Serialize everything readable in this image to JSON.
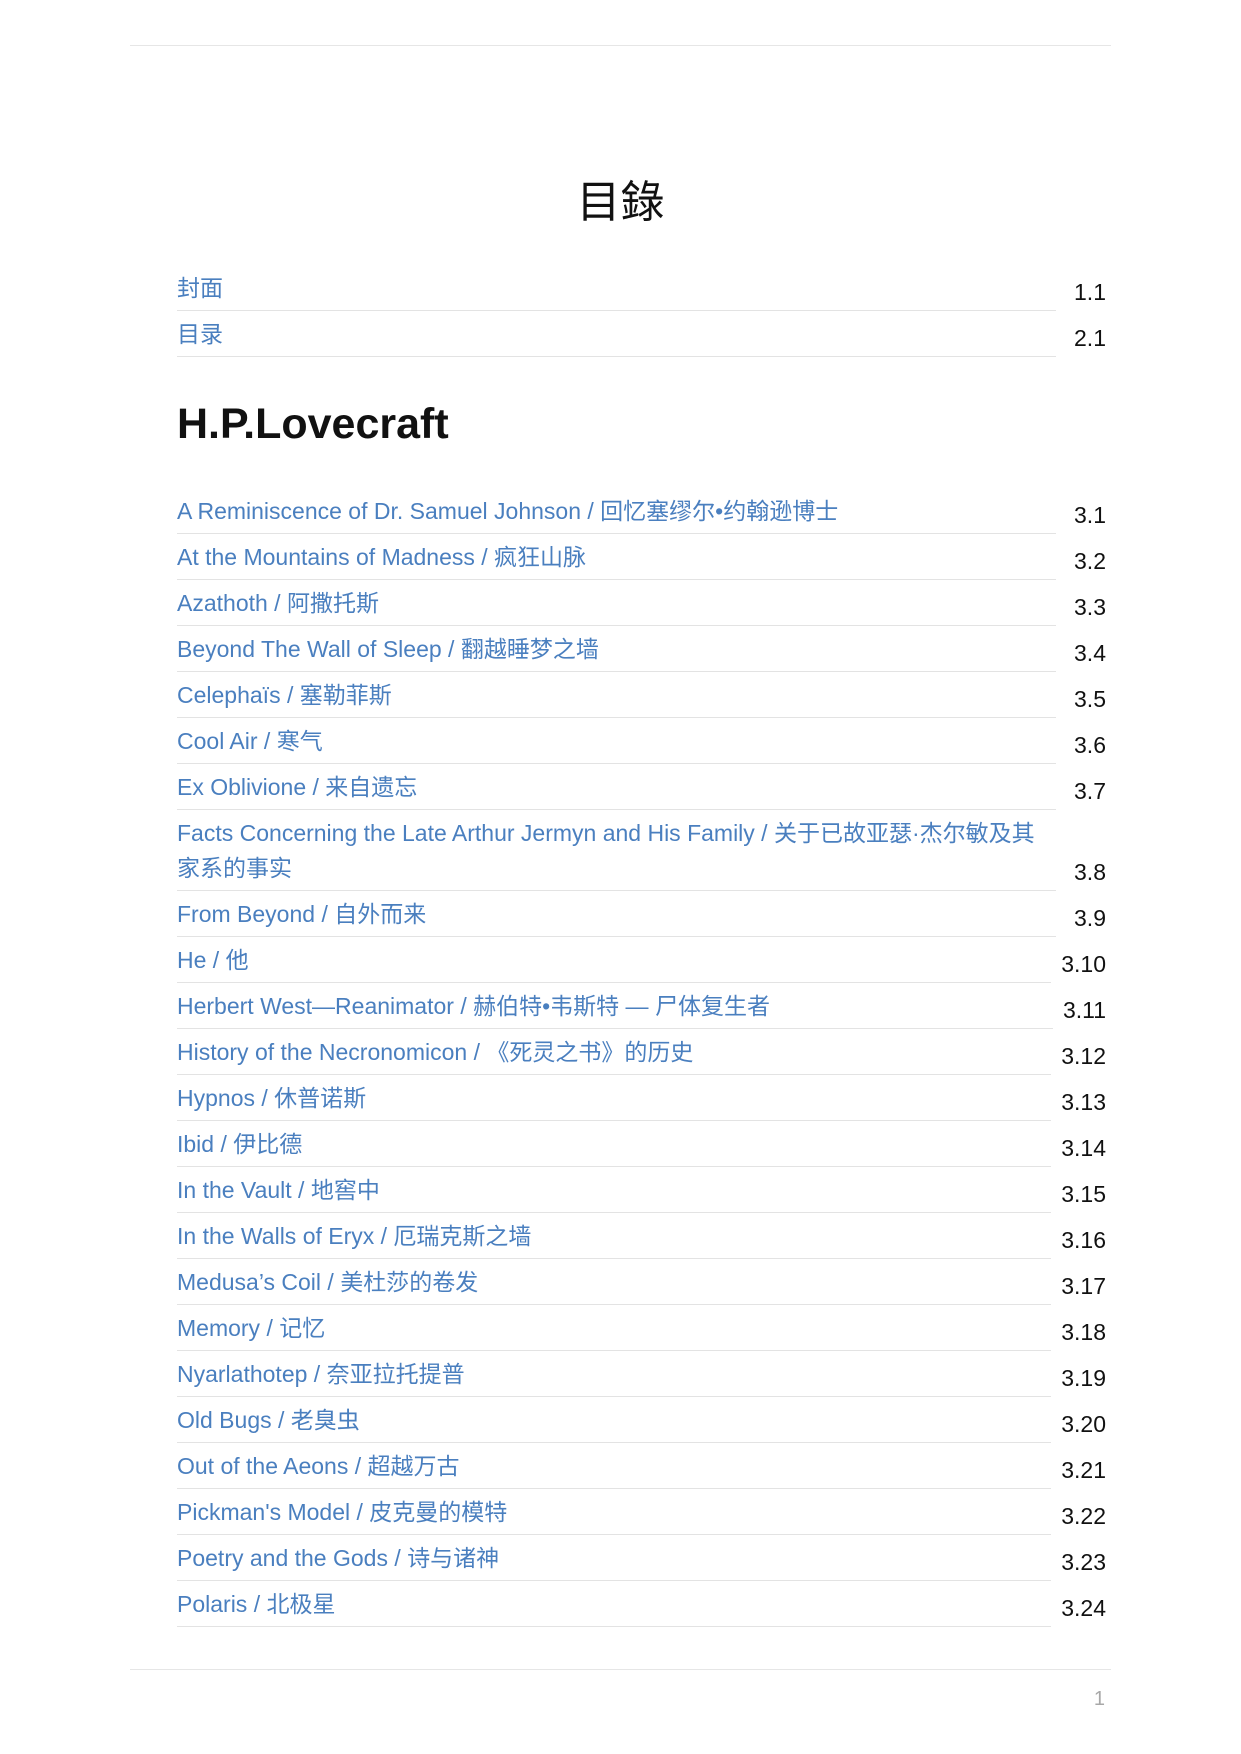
{
  "page_title": "目錄",
  "top_entries": [
    {
      "title": "封面",
      "number": "1.1"
    },
    {
      "title": "目录",
      "number": "2.1"
    }
  ],
  "section_heading": "H.P.Lovecraft",
  "entries": [
    {
      "title": "A Reminiscence of Dr. Samuel Johnson / 回忆塞缪尔•约翰逊博士",
      "number": "3.1"
    },
    {
      "title": "At the Mountains of Madness / 疯狂山脉",
      "number": "3.2"
    },
    {
      "title": "Azathoth / 阿撒托斯",
      "number": "3.3"
    },
    {
      "title": "Beyond The Wall of Sleep / 翻越睡梦之墙",
      "number": "3.4"
    },
    {
      "title": "Celephaïs / 塞勒菲斯",
      "number": "3.5"
    },
    {
      "title": "Cool Air / 寒气",
      "number": "3.6"
    },
    {
      "title": "Ex Oblivione / 来自遗忘",
      "number": "3.7"
    },
    {
      "title": "Facts Concerning the Late Arthur Jermyn and His Family / 关于已故亚瑟·杰尔敏及其家系的事实",
      "number": "3.8"
    },
    {
      "title": "From Beyond / 自外而来",
      "number": "3.9"
    },
    {
      "title": "He / 他",
      "number": "3.10"
    },
    {
      "title": "Herbert West—Reanimator / 赫伯特•韦斯特 — 尸体复生者",
      "number": "3.11"
    },
    {
      "title": "History of the Necronomicon / 《死灵之书》的历史",
      "number": "3.12"
    },
    {
      "title": "Hypnos / 休普诺斯",
      "number": "3.13"
    },
    {
      "title": "Ibid / 伊比德",
      "number": "3.14"
    },
    {
      "title": "In the Vault / 地窖中",
      "number": "3.15"
    },
    {
      "title": "In the Walls of Eryx / 厄瑞克斯之墙",
      "number": "3.16"
    },
    {
      "title": "Medusa’s Coil / 美杜莎的卷发",
      "number": "3.17"
    },
    {
      "title": "Memory / 记忆",
      "number": "3.18"
    },
    {
      "title": "Nyarlathotep / 奈亚拉托提普",
      "number": "3.19"
    },
    {
      "title": "Old Bugs / 老臭虫",
      "number": "3.20"
    },
    {
      "title": "Out of the Aeons / 超越万古",
      "number": "3.21"
    },
    {
      "title": "Pickman's Model / 皮克曼的模特",
      "number": "3.22"
    },
    {
      "title": "Poetry and the Gods / 诗与诸神",
      "number": "3.23"
    },
    {
      "title": "Polaris / 北极星",
      "number": "3.24"
    }
  ],
  "footer": {
    "page_number": "1"
  },
  "colors": {
    "link": "#4a7fbf",
    "rule": "#e3e3e3"
  }
}
